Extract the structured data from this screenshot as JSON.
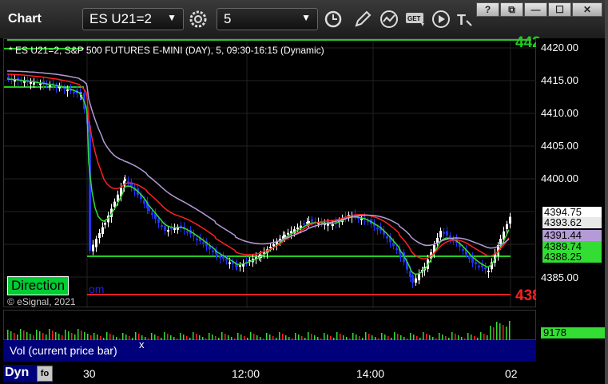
{
  "app": {
    "title": "Chart"
  },
  "toolbar": {
    "symbol": "ES U21=2",
    "interval": "5",
    "icons": [
      "refresh-gear-icon",
      "clock-icon",
      "pencil-icon",
      "study-icon",
      "get-icon",
      "play-icon",
      "text-icon"
    ]
  },
  "window_controls": [
    "help-button",
    "restore-button",
    "minimize-button",
    "maximize-button",
    "close-button"
  ],
  "window_labels": {
    "help": "?",
    "restore": "⧉",
    "minimize": "—",
    "maximize": "☐",
    "close": "✕"
  },
  "chart": {
    "description": "* ES U21=2, S&P 500 FUTURES E-MINI (DAY), 5, 09:30-16:15 (Dynamic)",
    "direction_label": "Direction",
    "direction_tail": "om",
    "copyright": "© eSignal, 2021",
    "red_level_text": "438",
    "green_level_text": "442",
    "price_axis": [
      "4420.00",
      "4415.00",
      "4410.00",
      "4405.00",
      "4400.00",
      "4385.00"
    ],
    "last_price": "4394.75",
    "tags": [
      {
        "text": "4393.62",
        "color": "#e8e8e8"
      },
      {
        "text": "4391.44",
        "color": "#b49bd8"
      },
      {
        "text": "4389.74",
        "color": "#33dd33"
      },
      {
        "text": "4388.25",
        "color": "#33dd33"
      }
    ],
    "time_axis": [
      "30",
      "12:00",
      "14:00",
      "02"
    ],
    "colors": {
      "up": "#ffffff",
      "down": "#2233ff",
      "ma_fast": "#33dd33",
      "ma_slow": "#ff2020",
      "ma_purple": "#b49bd8",
      "level_green": "#22cc22",
      "level_red": "#ff2020"
    }
  },
  "volume": {
    "label": "Vol (current price bar)",
    "close_glyph": "x",
    "value": "9178"
  },
  "footer": {
    "dyn": "Dyn",
    "dyn_icon": "fo"
  }
}
